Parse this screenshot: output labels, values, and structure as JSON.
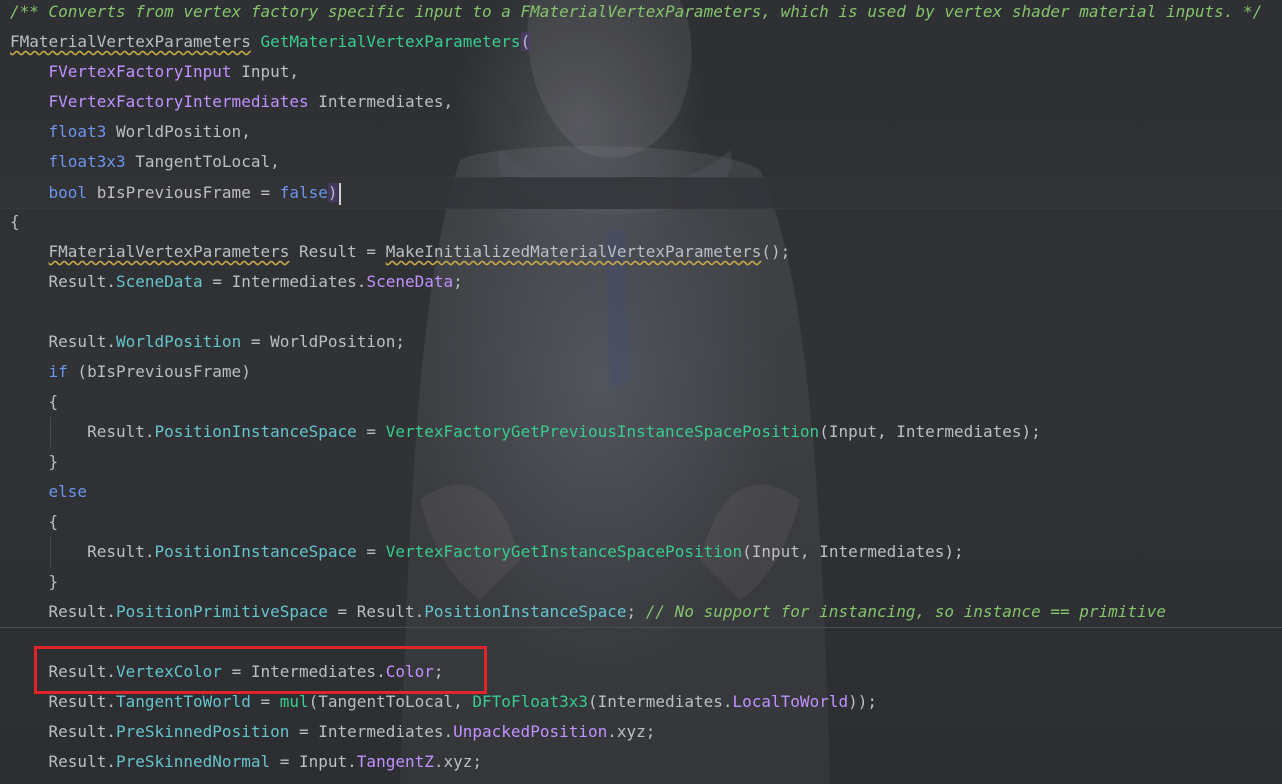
{
  "editor": {
    "lines": [
      {
        "id": "l0",
        "tokens": [
          {
            "t": "/** Converts from vertex factory specific input to a FMaterialVertexParameters, which is used by vertex shader material inputs. */",
            "c": "cmt"
          }
        ]
      },
      {
        "id": "l1",
        "tokens": [
          {
            "t": "FMaterialVertexParameters",
            "c": "ty-under"
          },
          {
            "t": " ",
            "c": "plain"
          },
          {
            "t": "GetMaterialVertexParameters",
            "c": "fn"
          },
          {
            "t": "(",
            "c": "paren-hl"
          }
        ]
      },
      {
        "id": "l2",
        "tokens": [
          {
            "t": "    ",
            "c": "plain"
          },
          {
            "t": "FVertexFactoryInput",
            "c": "ty"
          },
          {
            "t": " Input,",
            "c": "plain"
          }
        ]
      },
      {
        "id": "l3",
        "tokens": [
          {
            "t": "    ",
            "c": "plain"
          },
          {
            "t": "FVertexFactoryIntermediates",
            "c": "ty"
          },
          {
            "t": " Intermediates,",
            "c": "plain"
          }
        ]
      },
      {
        "id": "l4",
        "tokens": [
          {
            "t": "    ",
            "c": "plain"
          },
          {
            "t": "float3",
            "c": "kw"
          },
          {
            "t": " WorldPosition,",
            "c": "plain"
          }
        ]
      },
      {
        "id": "l5",
        "tokens": [
          {
            "t": "    ",
            "c": "plain"
          },
          {
            "t": "float3x3",
            "c": "kw"
          },
          {
            "t": " TangentToLocal,",
            "c": "plain"
          }
        ]
      },
      {
        "id": "l6",
        "tokens": [
          {
            "t": "    ",
            "c": "plain"
          },
          {
            "t": "bool",
            "c": "kw"
          },
          {
            "t": " bIsPreviousFrame = ",
            "c": "plain"
          },
          {
            "t": "false",
            "c": "kw"
          },
          {
            "t": ")",
            "c": "paren-hl"
          }
        ]
      },
      {
        "id": "l7",
        "tokens": [
          {
            "t": "{",
            "c": "plain"
          }
        ]
      },
      {
        "id": "l8",
        "tokens": [
          {
            "t": "    ",
            "c": "plain"
          },
          {
            "t": "FMaterialVertexParameters",
            "c": "ty-under"
          },
          {
            "t": " Result = ",
            "c": "plain"
          },
          {
            "t": "MakeInitializedMaterialVertexParameters",
            "c": "ty-under"
          },
          {
            "t": "();",
            "c": "plain"
          }
        ]
      },
      {
        "id": "l9",
        "tokens": [
          {
            "t": "    Result.",
            "c": "plain"
          },
          {
            "t": "SceneData",
            "c": "field"
          },
          {
            "t": " = Intermediates.",
            "c": "plain"
          },
          {
            "t": "SceneData",
            "c": "member"
          },
          {
            "t": ";",
            "c": "plain"
          }
        ]
      },
      {
        "id": "l10",
        "tokens": []
      },
      {
        "id": "l11",
        "tokens": [
          {
            "t": "    Result.",
            "c": "plain"
          },
          {
            "t": "WorldPosition",
            "c": "field"
          },
          {
            "t": " = WorldPosition;",
            "c": "plain"
          }
        ]
      },
      {
        "id": "l12",
        "tokens": [
          {
            "t": "    ",
            "c": "plain"
          },
          {
            "t": "if",
            "c": "kw"
          },
          {
            "t": " (bIsPreviousFrame)",
            "c": "plain"
          }
        ]
      },
      {
        "id": "l13",
        "tokens": [
          {
            "t": "    {",
            "c": "plain"
          }
        ]
      },
      {
        "id": "l14",
        "tokens": [
          {
            "t": "        Result.",
            "c": "plain"
          },
          {
            "t": "PositionInstanceSpace",
            "c": "field"
          },
          {
            "t": " = ",
            "c": "plain"
          },
          {
            "t": "VertexFactoryGetPreviousInstanceSpacePosition",
            "c": "fn"
          },
          {
            "t": "(Input, Intermediates);",
            "c": "plain"
          }
        ]
      },
      {
        "id": "l15",
        "tokens": [
          {
            "t": "    }",
            "c": "plain"
          }
        ]
      },
      {
        "id": "l16",
        "tokens": [
          {
            "t": "    ",
            "c": "plain"
          },
          {
            "t": "else",
            "c": "kw"
          }
        ]
      },
      {
        "id": "l17",
        "tokens": [
          {
            "t": "    {",
            "c": "plain"
          }
        ]
      },
      {
        "id": "l18",
        "tokens": [
          {
            "t": "        Result.",
            "c": "plain"
          },
          {
            "t": "PositionInstanceSpace",
            "c": "field"
          },
          {
            "t": " = ",
            "c": "plain"
          },
          {
            "t": "VertexFactoryGetInstanceSpacePosition",
            "c": "fn"
          },
          {
            "t": "(Input, Intermediates);",
            "c": "plain"
          }
        ]
      },
      {
        "id": "l19",
        "tokens": [
          {
            "t": "    }",
            "c": "plain"
          }
        ]
      },
      {
        "id": "l20",
        "tokens": [
          {
            "t": "    Result.",
            "c": "plain"
          },
          {
            "t": "PositionPrimitiveSpace",
            "c": "field"
          },
          {
            "t": " = Result.",
            "c": "plain"
          },
          {
            "t": "PositionInstanceSpace",
            "c": "field"
          },
          {
            "t": "; ",
            "c": "plain"
          },
          {
            "t": "// No support for instancing, so instance == primitive",
            "c": "cmt"
          }
        ]
      },
      {
        "id": "l21",
        "tokens": []
      },
      {
        "id": "l22",
        "tokens": [
          {
            "t": "    Result.",
            "c": "plain"
          },
          {
            "t": "VertexColor",
            "c": "field"
          },
          {
            "t": " = Intermediates.",
            "c": "plain"
          },
          {
            "t": "Color",
            "c": "member"
          },
          {
            "t": ";",
            "c": "plain"
          }
        ]
      },
      {
        "id": "l23",
        "tokens": [
          {
            "t": "    Result.",
            "c": "plain"
          },
          {
            "t": "TangentToWorld",
            "c": "field"
          },
          {
            "t": " = ",
            "c": "plain"
          },
          {
            "t": "mul",
            "c": "fn"
          },
          {
            "t": "(TangentToLocal, ",
            "c": "plain"
          },
          {
            "t": "DFToFloat3x3",
            "c": "fn"
          },
          {
            "t": "(Intermediates.",
            "c": "plain"
          },
          {
            "t": "LocalToWorld",
            "c": "member"
          },
          {
            "t": "));",
            "c": "plain"
          }
        ]
      },
      {
        "id": "l24",
        "tokens": [
          {
            "t": "    Result.",
            "c": "plain"
          },
          {
            "t": "PreSkinnedPosition",
            "c": "field"
          },
          {
            "t": " = Intermediates.",
            "c": "plain"
          },
          {
            "t": "UnpackedPosition",
            "c": "member"
          },
          {
            "t": ".xyz;",
            "c": "plain"
          }
        ]
      },
      {
        "id": "l25",
        "tokens": [
          {
            "t": "    Result.",
            "c": "plain"
          },
          {
            "t": "PreSkinnedNormal",
            "c": "field"
          },
          {
            "t": " = Input.",
            "c": "plain"
          },
          {
            "t": "TangentZ",
            "c": "member"
          },
          {
            "t": ".xyz;",
            "c": "plain"
          }
        ]
      }
    ],
    "current_line": "l6",
    "highlighted_line": "l22"
  },
  "colors": {
    "background": "#2e3033",
    "comment": "#85c46c",
    "keyword": "#6c95eb",
    "type": "#c191ff",
    "function": "#39cc8f",
    "field": "#66c3cc",
    "text": "#bcbec4",
    "highlight_box": "#e0242a"
  }
}
